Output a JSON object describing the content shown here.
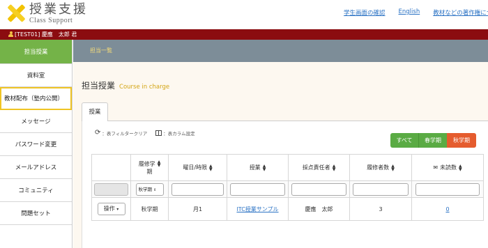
{
  "logo": {
    "title": "授業支援",
    "subtitle": "Class Support"
  },
  "top_links": [
    "学生画面の確認",
    "English",
    "教材などの著作権につ"
  ],
  "user": {
    "label": "[TEST01] 慶應　太郎 君"
  },
  "sidebar": {
    "items": [
      {
        "label": "担当授業",
        "active": true
      },
      {
        "label": "資料室"
      },
      {
        "label": "教材配布（塾内公開）",
        "highlight": true
      },
      {
        "label": "メッセージ"
      },
      {
        "label": "パスワード変更"
      },
      {
        "label": "メールアドレス"
      },
      {
        "label": "コミュニティ"
      },
      {
        "label": "問題セット"
      }
    ]
  },
  "breadcrumb": "担当一覧",
  "page": {
    "title": "担当授業",
    "title_en": "Course in charge"
  },
  "tab": "授業",
  "toolbar": {
    "clear_filter": "：表フィルタークリア",
    "column_settings": "：表カラム設定"
  },
  "term_filter": {
    "all": "すべて",
    "spring": "春学期",
    "fall": "秋学期",
    "selected": "fall"
  },
  "table": {
    "headers": {
      "term_line1": "履修学",
      "term_line2": "期",
      "day_period": "曜日/時限",
      "course": "授業",
      "grader": "採点責任者",
      "enrolled": "履修者数",
      "unread": "未読数"
    },
    "filter": {
      "term_value": "秋学期"
    },
    "rows": [
      {
        "action": "操作",
        "term": "秋学期",
        "day_period": "月1",
        "course": "ITC授業サンプル",
        "grader": "慶應　太郎",
        "enrolled": "3",
        "unread": "0"
      }
    ]
  },
  "colors": {
    "sidebar_active": "#74b348",
    "user_bar": "#8b0c10",
    "breadcrumb_bar": "#7d8d98",
    "fall_button": "#e55c2e",
    "spring_button": "#5aab44",
    "link": "#2a72c4",
    "highlight_outline": "#f0c423"
  }
}
